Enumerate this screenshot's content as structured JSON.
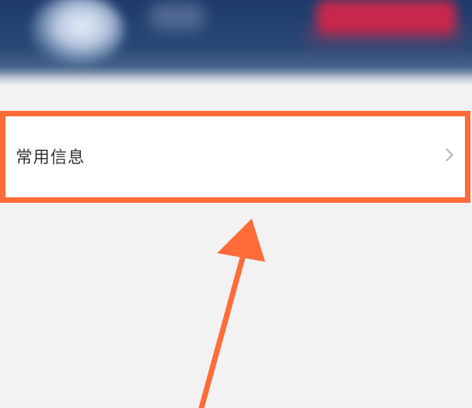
{
  "settings_list": {
    "items": [
      {
        "label": "常用信息",
        "icon": "chevron-right-icon"
      }
    ]
  },
  "colors": {
    "highlight": "#ff6c3a",
    "header_background": "#2a4876",
    "header_button": "#c7284b",
    "page_background": "#f2f2f2"
  }
}
